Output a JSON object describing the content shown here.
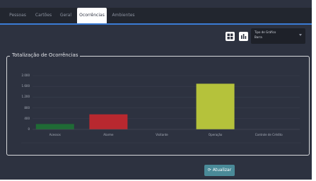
{
  "tabs": [
    {
      "label": "Pessoas",
      "active": false
    },
    {
      "label": "Cartões",
      "active": false
    },
    {
      "label": "Geral",
      "active": false
    },
    {
      "label": "Ocorrências",
      "active": true
    },
    {
      "label": "Ambientes",
      "active": false
    }
  ],
  "toolbar": {
    "table_view_icon": "grid-table-icon",
    "chart_view_icon": "bar-chart-icon",
    "chart_type": {
      "label": "Tipo de Gráfico",
      "value": "Barra"
    }
  },
  "panel": {
    "legend": "Totalização de Ocorrências"
  },
  "chart_data": {
    "type": "bar",
    "categories": [
      "Acessos",
      "Alarme",
      "Visitante",
      "Operação",
      "Controle de Crédito"
    ],
    "values": [
      200,
      560,
      0,
      1700,
      0
    ],
    "ylim": [
      0,
      2000
    ],
    "yticks": [
      "2.000",
      "1.600",
      "1.200",
      "800",
      "400",
      "0"
    ],
    "colors": [
      "#1f6b35",
      "#b8282f",
      "#7a7f8a",
      "#b5c23b",
      "#7a7f8a"
    ],
    "grid": true
  },
  "refresh_button": {
    "label": "Atualizar",
    "icon": "refresh-icon"
  }
}
